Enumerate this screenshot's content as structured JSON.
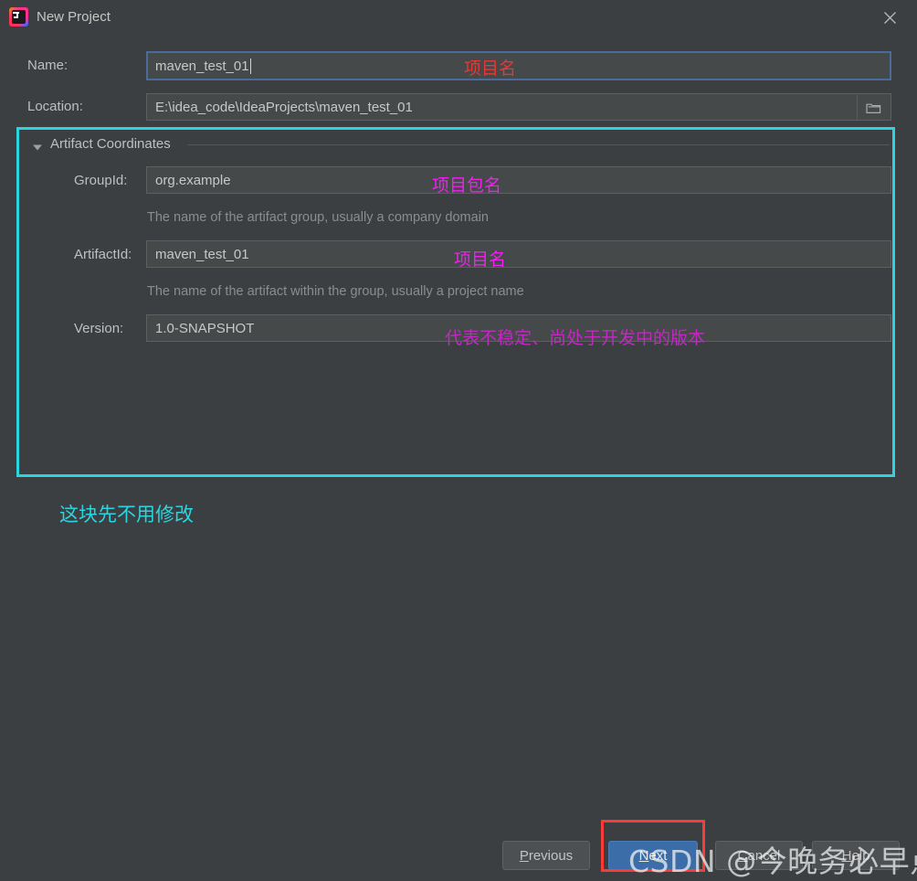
{
  "window": {
    "title": "New Project",
    "app_icon": "intellij-idea-icon",
    "close_icon": "close-icon"
  },
  "form": {
    "name_label": "Name:",
    "name_value": "maven_test_01",
    "location_label": "Location:",
    "location_value": "E:\\idea_code\\IdeaProjects\\maven_test_01",
    "browse_icon": "folder-icon"
  },
  "artifact_group": {
    "title": "Artifact Coordinates",
    "twisty_icon": "triangle-down-icon",
    "expanded": true,
    "fields": [
      {
        "label": "GroupId:",
        "value": "org.example",
        "hint": "The name of the artifact group, usually a company domain"
      },
      {
        "label": "ArtifactId:",
        "value": "maven_test_01",
        "hint": "The name of the artifact within the group, usually a project name"
      },
      {
        "label": "Version:",
        "value": "1.0-SNAPSHOT",
        "hint": ""
      }
    ]
  },
  "annotations": [
    {
      "text": "项目名",
      "color": "#e33a35",
      "target": "name-field"
    },
    {
      "text": "项目包名",
      "color": "#f020f0",
      "target": "groupid-field"
    },
    {
      "text": "项目名",
      "color": "#f020f0",
      "target": "artifactid-field"
    },
    {
      "text": "代表不稳定、尚处于开发中的版本",
      "color": "#c02ac0",
      "target": "version-field"
    },
    {
      "text": "这块先不用修改",
      "color": "#2bd5e0",
      "target": "artifact-coordinates-group"
    }
  ],
  "highlight_boxes": {
    "cyan_border_color": "#2bd5e0",
    "red_border_color": "#fb3b35"
  },
  "buttons": {
    "previous": {
      "label": "Previous",
      "mnemonic": "P"
    },
    "next": {
      "label": "Next",
      "mnemonic": "N",
      "default": true
    },
    "cancel": {
      "label": "Cancel",
      "mnemonic": "C"
    },
    "help": {
      "label": "Help",
      "mnemonic": "H"
    }
  },
  "watermark": {
    "text": "CSDN @今晚务必早点睡"
  },
  "colors": {
    "dialog_background": "#3c3f41",
    "field_background": "#45494a",
    "field_border": "#5e6060",
    "focus_border": "#4a6c9b",
    "default_button": "#3b6ea8",
    "text_primary": "#bfbfbf",
    "text_hint": "#8a8d8e"
  }
}
